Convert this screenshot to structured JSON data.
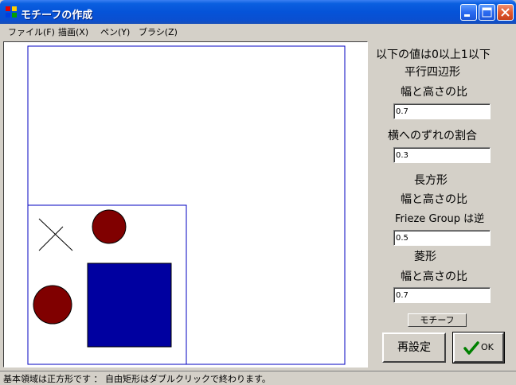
{
  "window": {
    "title": "モチーフの作成"
  },
  "menu": [
    {
      "label": "ファイル(F)"
    },
    {
      "label": "描画(X)"
    },
    {
      "label": "ペン(Y)"
    },
    {
      "label": "ブラシ(Z)"
    }
  ],
  "panel": {
    "range_note": "以下の値は0以上1以下",
    "parallelogram_label": "平行四辺形",
    "ratio_label_1": "幅と高さの比",
    "ratio_value_1": "0.7",
    "shift_label": "横へのずれの割合",
    "shift_value": "0.3",
    "rectangle_label": "長方形",
    "ratio_label_2": "幅と高さの比",
    "frieze_note": "Frieze Group は逆",
    "ratio_value_2": "0.5",
    "rhombus_label": "菱形",
    "ratio_label_3": "幅と高さの比",
    "ratio_value_3": "0.7",
    "motif_button": "モチーフ",
    "reset_button": "再設定",
    "ok_button": "OK"
  },
  "colors": {
    "frame_blue": "#0000c0",
    "shape_blue": "#0000a0",
    "circle_red": "#800000",
    "ok_check_green": "#008000"
  },
  "status": {
    "text": "基本領域は正方形です ： 自由矩形はダブルクリックで終わります。"
  }
}
